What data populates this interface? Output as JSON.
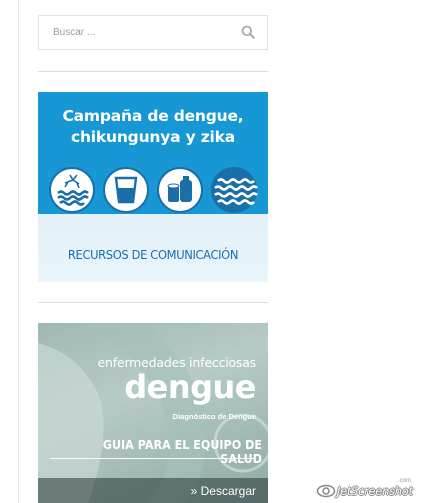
{
  "search": {
    "placeholder": "Buscar ...",
    "icon": "search-icon"
  },
  "banner_campana": {
    "title_line1": "Campaña de dengue,",
    "title_line2": "chikungunya y zika",
    "icons": [
      "mosquito-water-icon",
      "water-glass-icon",
      "containers-icon",
      "water-waves-icon"
    ],
    "footer": "RECURSOS DE COMUNICACIÓN",
    "colors": {
      "top": "#1797d3",
      "footer_text": "#1a6fa8"
    }
  },
  "banner_guia": {
    "subtitle": "enfermedades infecciosas",
    "headline": "dengue",
    "diagnosis": "Diagnóstico de Dengue",
    "guide": "GUIA PARA EL EQUIPO DE SALUD",
    "download": "» Descargar"
  },
  "watermark": {
    "text": "JetScreenshot",
    "suffix": ".com"
  }
}
